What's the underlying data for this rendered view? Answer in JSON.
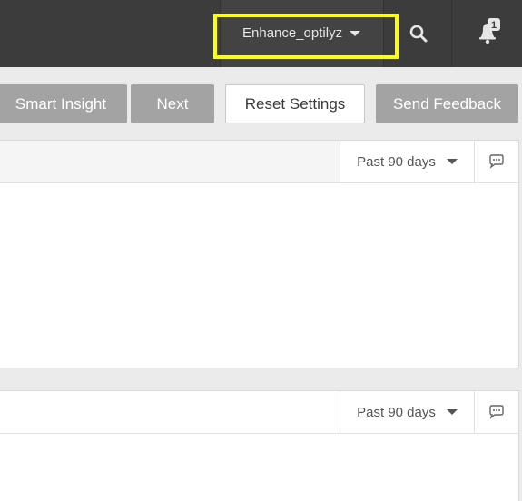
{
  "header": {
    "user_name": "Enhance_optilyz",
    "notification_count": "1"
  },
  "toolbar": {
    "smart_insight_label": "Smart Insight",
    "next_label": "Next",
    "reset_label": "Reset Settings",
    "feedback_label": "Send Feedback"
  },
  "panels": [
    {
      "period": "Past 90 days"
    },
    {
      "period": "Past 90 days"
    }
  ],
  "icons": {
    "search": "search-icon",
    "bell": "bell-icon",
    "comment": "comment-icon",
    "dropdown": "chevron-down-icon"
  },
  "colors": {
    "topbar": "#3c3c3c",
    "highlight": "#ffff00",
    "gray_button": "#a3a3a3"
  }
}
